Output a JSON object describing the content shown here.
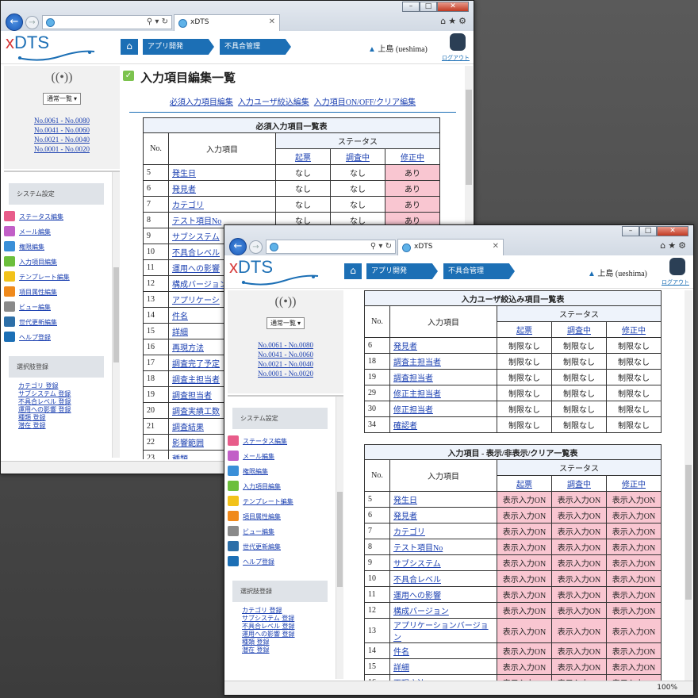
{
  "browser": {
    "tab_title": "xDTS",
    "zoom": "100%"
  },
  "app": {
    "logo_x": "x",
    "logo_rest": "DTS",
    "breadcrumb": [
      "アプリ開発",
      "不具合管理"
    ],
    "user": "上島 (ueshima)",
    "logout": "ログアウト"
  },
  "sidebar": {
    "view_select": "通常一覧",
    "ranges": [
      "No.0061 - No.0080",
      "No.0041 - No.0060",
      "No.0021 - No.0040",
      "No.0001 - No.0020"
    ],
    "group1": "システム設定",
    "items": [
      {
        "label": "ステータス編集",
        "icon": "status-icon",
        "color": "#e85c8a"
      },
      {
        "label": "メール編集",
        "icon": "mail-icon",
        "color": "#c25fc7"
      },
      {
        "label": "権限編集",
        "icon": "users-icon",
        "color": "#3a8fd8"
      },
      {
        "label": "入力項目編集",
        "icon": "check-icon",
        "color": "#6cbf3c"
      },
      {
        "label": "テンプレート編集",
        "icon": "template-icon",
        "color": "#f2c21a"
      },
      {
        "label": "項目属性編集",
        "icon": "attribute-icon",
        "color": "#f08a1c"
      },
      {
        "label": "ビュー編集",
        "icon": "eye-icon",
        "color": "#8a8a8a"
      },
      {
        "label": "世代更新編集",
        "icon": "generation-icon",
        "color": "#2d6fa8"
      },
      {
        "label": "ヘルプ登録",
        "icon": "help-icon",
        "color": "#1c6fb5"
      }
    ],
    "group2": "選択肢登録",
    "sub_items": [
      "カテゴリ 登録",
      "サブシステム 登録",
      "不具合レベル 登録",
      "運用への影響 登録",
      "種類 登録",
      "潜在 登録"
    ]
  },
  "page": {
    "title": "入力項目編集一覧",
    "links": [
      "必須入力項目編集",
      "入力ユーザ絞込編集",
      "入力項目ON/OFF/クリア編集"
    ]
  },
  "cols": {
    "no": "No.",
    "item": "入力項目",
    "status": "ステータス",
    "s1": "起票",
    "s2": "調査中",
    "s3": "修正中"
  },
  "required_table": {
    "caption": "必須入力項目一覧表",
    "rows": [
      [
        "5",
        "発生日",
        "なし",
        "なし",
        "あり"
      ],
      [
        "6",
        "発見者",
        "なし",
        "なし",
        "あり"
      ],
      [
        "7",
        "カテゴリ",
        "なし",
        "なし",
        "あり"
      ],
      [
        "8",
        "テスト項目No",
        "なし",
        "なし",
        "あり"
      ],
      [
        "9",
        "サブシステム"
      ],
      [
        "10",
        "不具合レベル"
      ],
      [
        "11",
        "運用への影響"
      ],
      [
        "12",
        "構成バージョン"
      ],
      [
        "13",
        "アプリケーシ"
      ],
      [
        "14",
        "件名"
      ],
      [
        "15",
        "詳細"
      ],
      [
        "16",
        "再現方法"
      ],
      [
        "17",
        "調査完了予定"
      ],
      [
        "18",
        "調査主担当者"
      ],
      [
        "19",
        "調査担当者"
      ],
      [
        "20",
        "調査実績工数"
      ],
      [
        "21",
        "調査結果"
      ],
      [
        "22",
        "影響範囲"
      ],
      [
        "23",
        "種類"
      ]
    ]
  },
  "user_table": {
    "caption": "入力ユーザ絞込み項目一覧表",
    "rows": [
      [
        "6",
        "発見者",
        "制限なし",
        "制限なし",
        "制限なし"
      ],
      [
        "18",
        "調査主担当者",
        "制限なし",
        "制限なし",
        "制限なし"
      ],
      [
        "19",
        "調査担当者",
        "制限なし",
        "制限なし",
        "制限なし"
      ],
      [
        "29",
        "修正主担当者",
        "制限なし",
        "制限なし",
        "制限なし"
      ],
      [
        "30",
        "修正担当者",
        "制限なし",
        "制限なし",
        "制限なし"
      ],
      [
        "34",
        "確認者",
        "制限なし",
        "制限なし",
        "制限なし"
      ]
    ]
  },
  "display_table": {
    "caption": "入力項目 - 表示/非表示/クリア一覧表",
    "rows": [
      [
        "5",
        "発生日",
        "表示入力ON",
        "表示入力ON",
        "表示入力ON"
      ],
      [
        "6",
        "発見者",
        "表示入力ON",
        "表示入力ON",
        "表示入力ON"
      ],
      [
        "7",
        "カテゴリ",
        "表示入力ON",
        "表示入力ON",
        "表示入力ON"
      ],
      [
        "8",
        "テスト項目No",
        "表示入力ON",
        "表示入力ON",
        "表示入力ON"
      ],
      [
        "9",
        "サブシステム",
        "表示入力ON",
        "表示入力ON",
        "表示入力ON"
      ],
      [
        "10",
        "不具合レベル",
        "表示入力ON",
        "表示入力ON",
        "表示入力ON"
      ],
      [
        "11",
        "運用への影響",
        "表示入力ON",
        "表示入力ON",
        "表示入力ON"
      ],
      [
        "12",
        "構成バージョン",
        "表示入力ON",
        "表示入力ON",
        "表示入力ON"
      ],
      [
        "13",
        "アプリケーションバージョン",
        "表示入力ON",
        "表示入力ON",
        "表示入力ON"
      ],
      [
        "14",
        "件名",
        "表示入力ON",
        "表示入力ON",
        "表示入力ON"
      ],
      [
        "15",
        "詳細",
        "表示入力ON",
        "表示入力ON",
        "表示入力ON"
      ],
      [
        "16",
        "再現方法",
        "表示入力ON",
        "表示入力ON",
        "表示入力ON"
      ]
    ]
  }
}
